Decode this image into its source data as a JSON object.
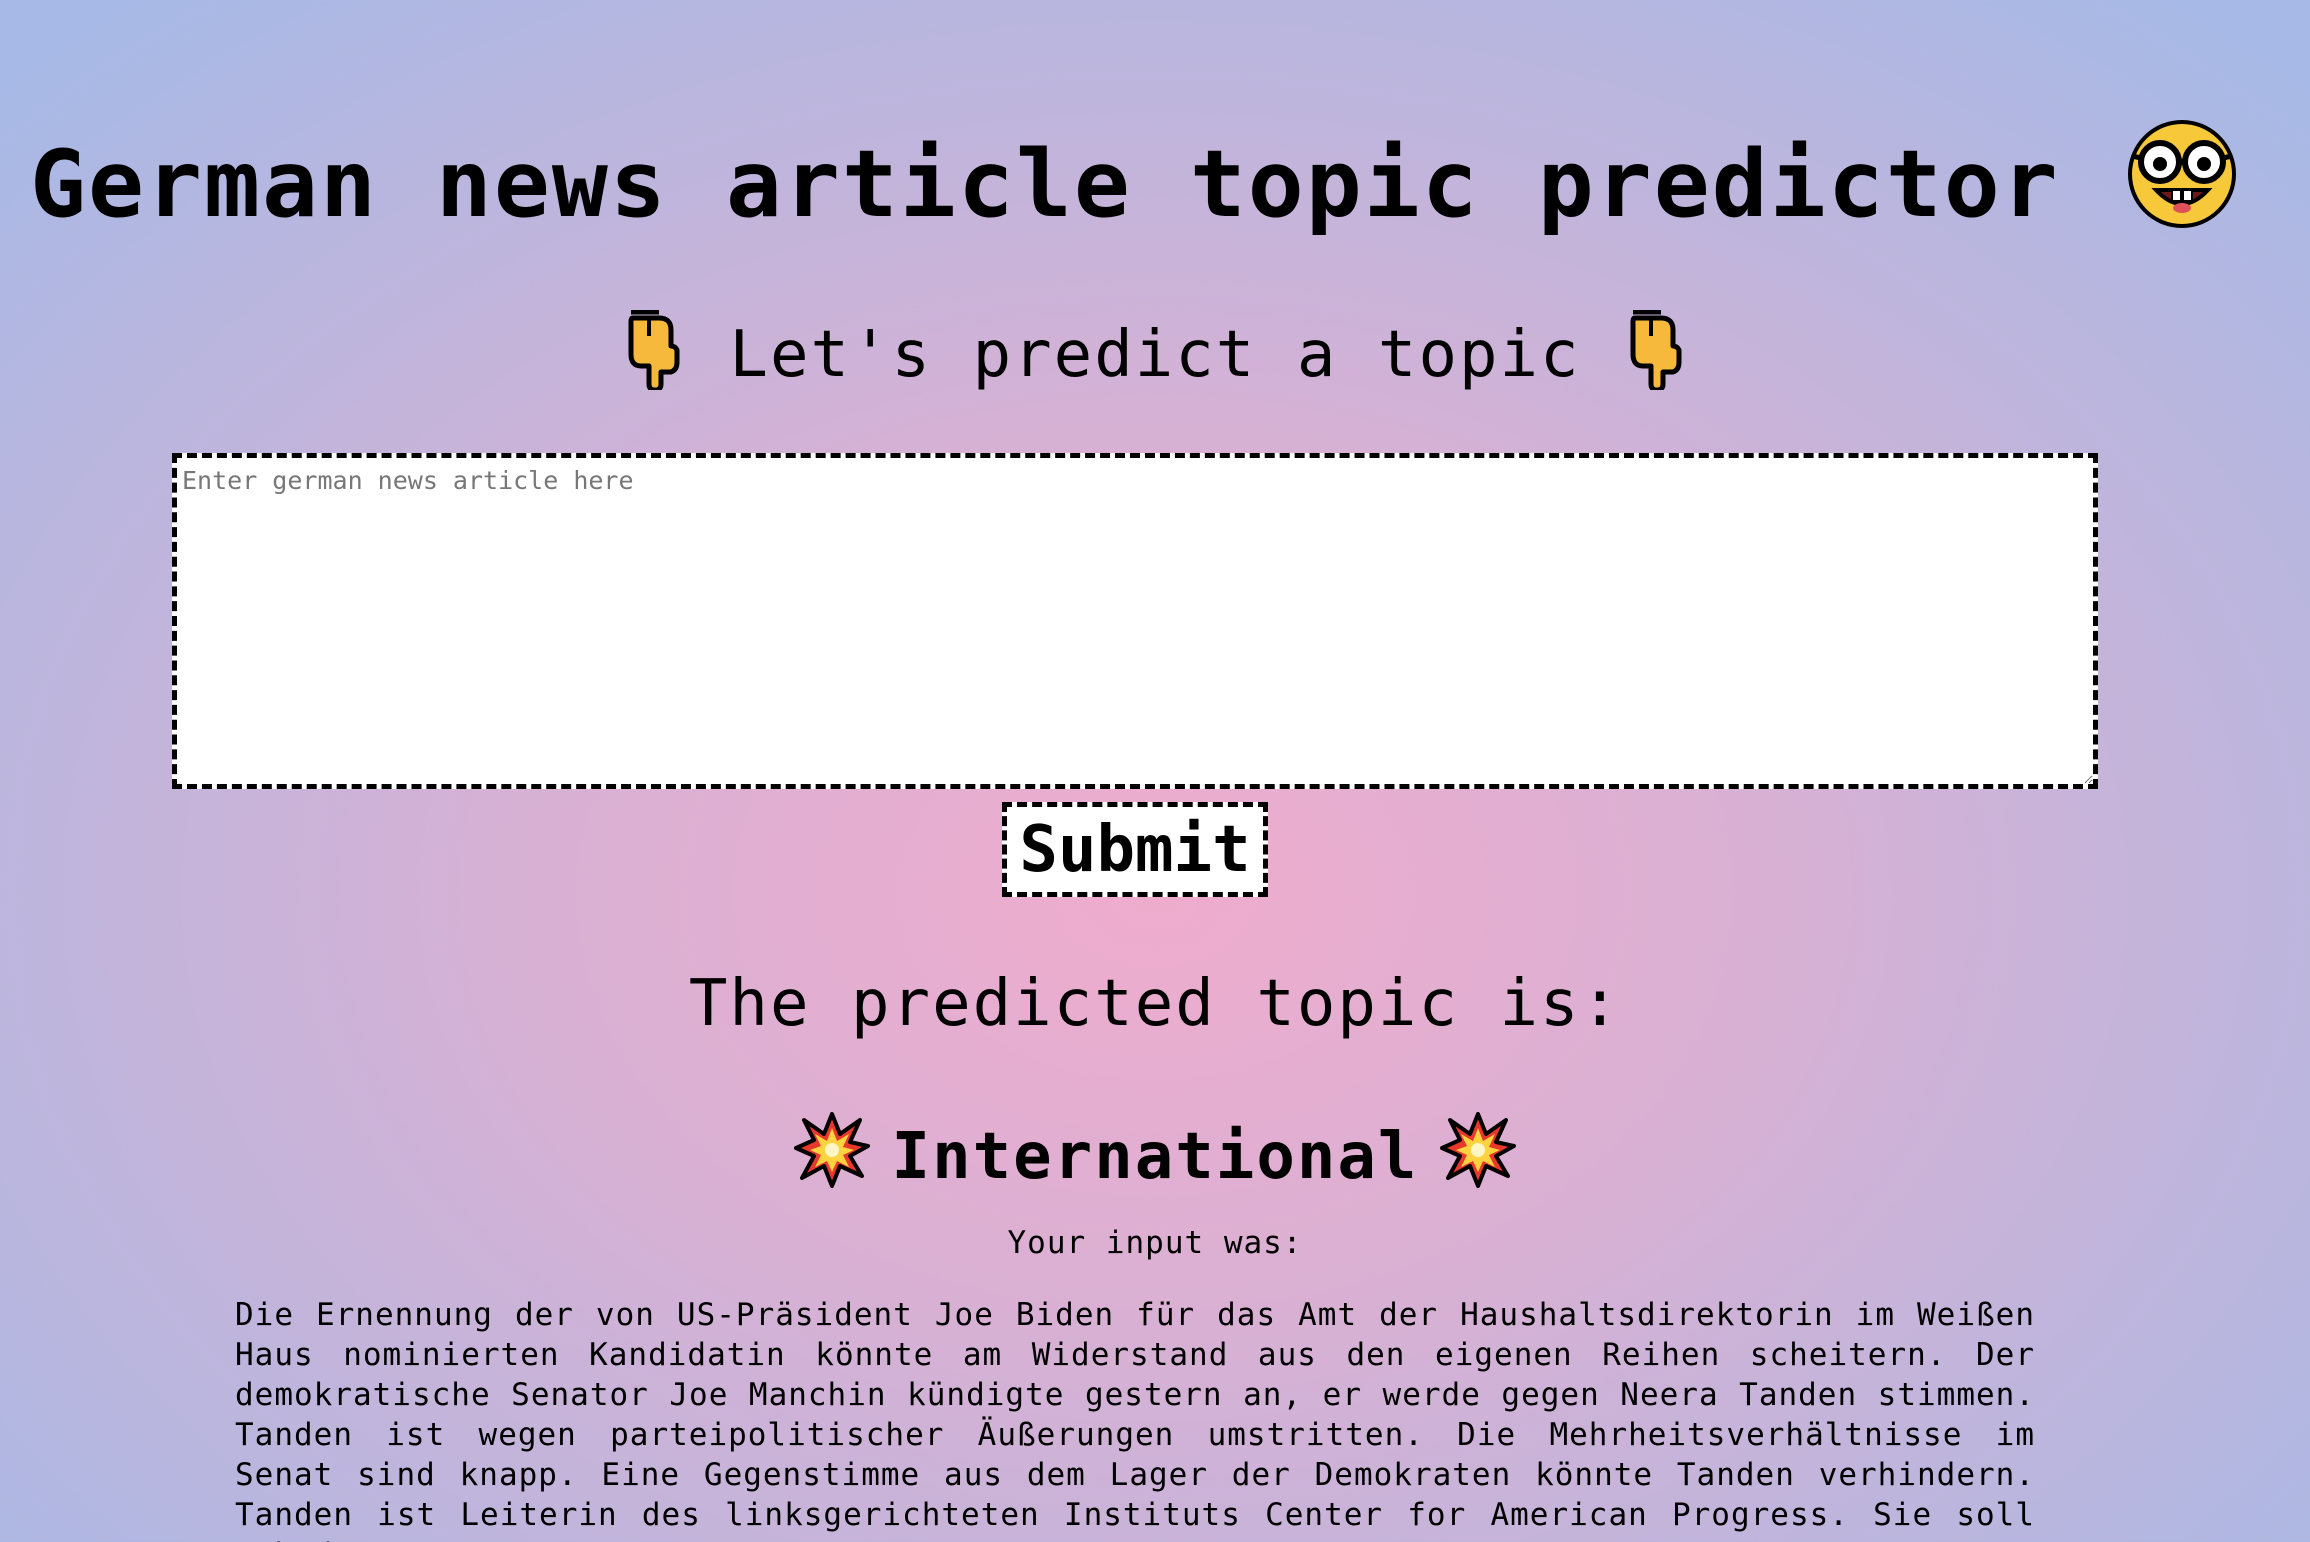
{
  "header": {
    "title": "German news article topic predictor",
    "title_emoji": "nerd-face-icon"
  },
  "prompt": {
    "text": "Let's predict a topic",
    "left_emoji": "backhand-index-pointing-down-icon",
    "right_emoji": "backhand-index-pointing-down-icon"
  },
  "form": {
    "textarea_placeholder": "Enter german news article here",
    "textarea_value": "",
    "submit_label": "Submit"
  },
  "result": {
    "label": "The predicted topic is:",
    "topic": "International",
    "topic_emoji": "collision-icon",
    "input_label": "Your input was:",
    "input_text": "Die Ernennung der von US-Präsident Joe Biden für das Amt der Haushaltsdirektorin im Weißen Haus nominierten Kandidatin könnte am Widerstand aus den eigenen Reihen scheitern. Der demokratische Senator Joe Manchin kündigte gestern an, er werde gegen Neera Tanden stimmen. Tanden ist wegen parteipolitischer Äußerungen umstritten. Die Mehrheitsverhältnisse im Senat sind knapp. Eine Gegenstimme aus dem Lager der Demokraten könnte Tanden verhindern. Tanden ist Leiterin des linksgerichteten Instituts Center for American Progress. Sie soll ach dem"
  },
  "colors": {
    "background_center": "#efaccd",
    "background_edge": "#a7b9e6",
    "text": "#000000",
    "field_background": "#ffffff"
  }
}
